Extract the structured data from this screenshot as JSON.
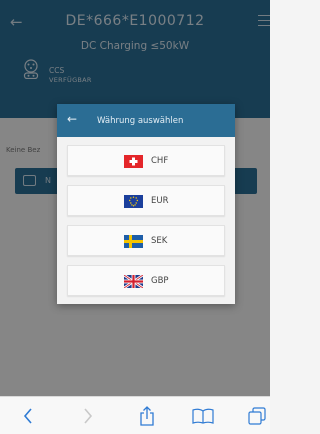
{
  "header": {
    "station_id": "DE*666*E1000712",
    "subtitle": "DC Charging ≤50kW",
    "plug_type": "CCS",
    "plug_status": "VERFÜGBAR"
  },
  "background": {
    "info_text": "Keine Bez",
    "button_label": "N"
  },
  "modal": {
    "title": "Währung auswählen",
    "currencies": [
      {
        "code": "CHF",
        "flag": "switzerland-flag"
      },
      {
        "code": "EUR",
        "flag": "eu-flag"
      },
      {
        "code": "SEK",
        "flag": "sweden-flag"
      },
      {
        "code": "GBP",
        "flag": "uk-flag"
      }
    ]
  },
  "toolbar": {
    "icons": [
      "chevron-left-icon",
      "chevron-right-icon",
      "share-icon",
      "book-icon",
      "tabs-icon"
    ]
  },
  "colors": {
    "primary": "#2b6d94",
    "modal_background": "#f2f2f2"
  }
}
